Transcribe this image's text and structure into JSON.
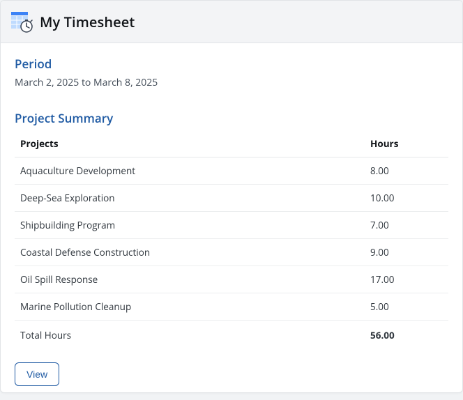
{
  "header": {
    "title": "My Timesheet"
  },
  "period": {
    "label": "Period",
    "range": "March 2, 2025 to March 8, 2025"
  },
  "summary": {
    "label": "Project Summary",
    "columns": {
      "projects": "Projects",
      "hours": "Hours"
    },
    "rows": [
      {
        "project": "Aquaculture Development",
        "hours": "8.00"
      },
      {
        "project": "Deep-Sea Exploration",
        "hours": "10.00"
      },
      {
        "project": "Shipbuilding Program",
        "hours": "7.00"
      },
      {
        "project": "Coastal Defense Construction",
        "hours": "9.00"
      },
      {
        "project": "Oil Spill Response",
        "hours": "17.00"
      },
      {
        "project": "Marine Pollution Cleanup",
        "hours": "5.00"
      }
    ],
    "total_label": "Total Hours",
    "total_hours": "56.00"
  },
  "actions": {
    "view": "View"
  },
  "colors": {
    "accent": "#1f5aa3",
    "icon_blue": "#3b82f6",
    "icon_light": "#bfdbfe"
  }
}
